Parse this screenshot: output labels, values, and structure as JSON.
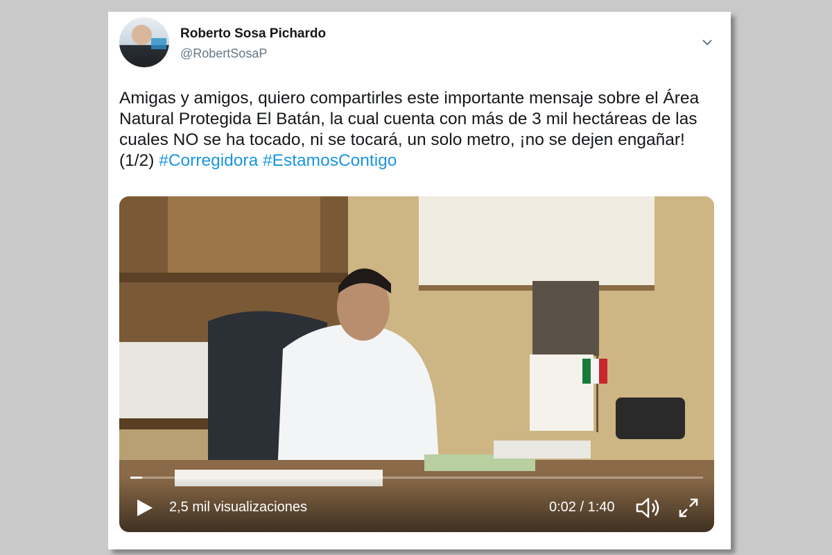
{
  "tweet": {
    "author_name": "Roberto Sosa Pichardo",
    "author_handle": "@RobertSosaP",
    "text": "Amigas y amigos, quiero compartirles este importante mensaje sobre el Área Natural Protegida El Batán, la cual cuenta con más de 3 mil hectáreas de las cuales NO se ha tocado, ni se tocará, un solo metro, ¡no se dejen engañar!(1/2)",
    "hashtags": [
      "#Corregidora",
      "#EstamosContigo"
    ],
    "menu_icon": "chevron-down-icon"
  },
  "video": {
    "views": "2,5 mil visualizaciones",
    "time": "0:02 / 1:40",
    "progress_fraction": 0.02,
    "icons": [
      "play-icon",
      "volume-icon",
      "fullscreen-icon"
    ]
  },
  "colors": {
    "page_background": "#c9c9c9",
    "card_background": "#ffffff",
    "hashtag": "#1b95e0",
    "handle": "#657786",
    "text": "#14171a"
  }
}
